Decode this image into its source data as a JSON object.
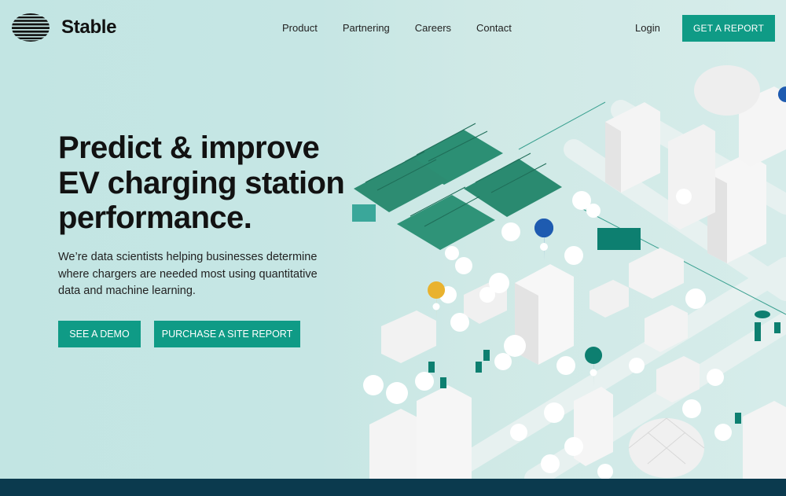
{
  "header": {
    "brand": "Stable",
    "nav": [
      "Product",
      "Partnering",
      "Careers",
      "Contact"
    ],
    "login": "Login",
    "cta": "GET A REPORT"
  },
  "hero": {
    "headline": "Predict & improve EV charging station performance.",
    "subtext": "We’re data scientists helping businesses determine where chargers are needed most using quantitative data and machine learning.",
    "buttons": {
      "demo": "SEE A DEMO",
      "report": "PURCHASE A SITE REPORT"
    }
  },
  "colors": {
    "accent": "#0f9b86",
    "background": "#c2e5e3",
    "footer_band": "#0b3a4e",
    "pin_blue": "#1e5bb0",
    "pin_yellow": "#e9b22e",
    "pin_teal": "#0d7f70"
  },
  "illustration": {
    "icons": [
      "solar-panel-icon",
      "building-icon",
      "tree-icon",
      "charger-icon",
      "map-pin-icon",
      "dome-icon"
    ]
  }
}
